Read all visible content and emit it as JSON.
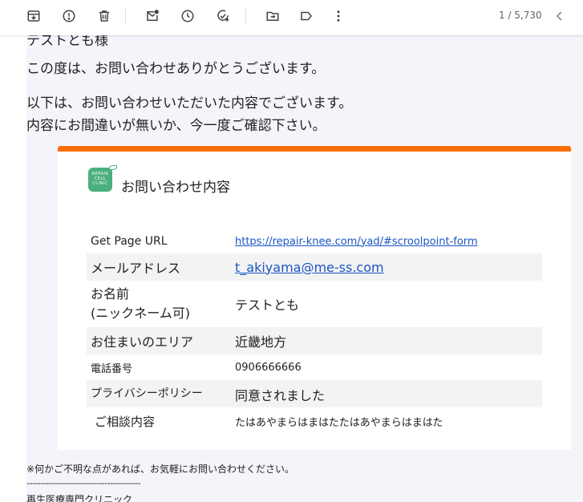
{
  "toolbar": {
    "buttons": [
      "archive-icon",
      "report-spam-icon",
      "delete-icon",
      "mark-unread-icon",
      "snooze-icon",
      "add-task-icon",
      "move-to-icon",
      "label-icon",
      "more-icon"
    ],
    "counter": "1 / 5,730"
  },
  "email": {
    "cut_text": "テストとも様",
    "para1": "この度は、お問い合わせありがとうございます。",
    "para2_line1": "以下は、お問い合わせいただいた内容でございます。",
    "para2_line2": "内容にお間違いが無いか、今一度ご確認下さい。",
    "card": {
      "accent_color": "#ff6f00",
      "logo_text": "REPAIR CELL CLINIC",
      "title": "お問い合わせ内容",
      "rows": [
        {
          "label": "Get Page URL",
          "value": "https://repair-knee.com/yad/#scroolpoint-form"
        },
        {
          "label": "メールアドレス",
          "value": "t_akiyama@me-ss.com"
        },
        {
          "label": "お名前",
          "label2": "(ニックネーム可)",
          "value": "テストとも"
        },
        {
          "label": "お住まいのエリア",
          "value": "近畿地方"
        },
        {
          "label": "電話番号",
          "value": "0906666666"
        },
        {
          "label": "プライバシーポリシー",
          "value": "同意されました"
        },
        {
          "label": "ご相談内容",
          "value": "たはあやまらはまはたたはあやまらはまはた"
        }
      ]
    },
    "note": "※何かご不明な点があれば、お気軽にお問い合わせください。",
    "divider": "-----------------------------------------",
    "clinic": "再生医療専門クリニック"
  }
}
